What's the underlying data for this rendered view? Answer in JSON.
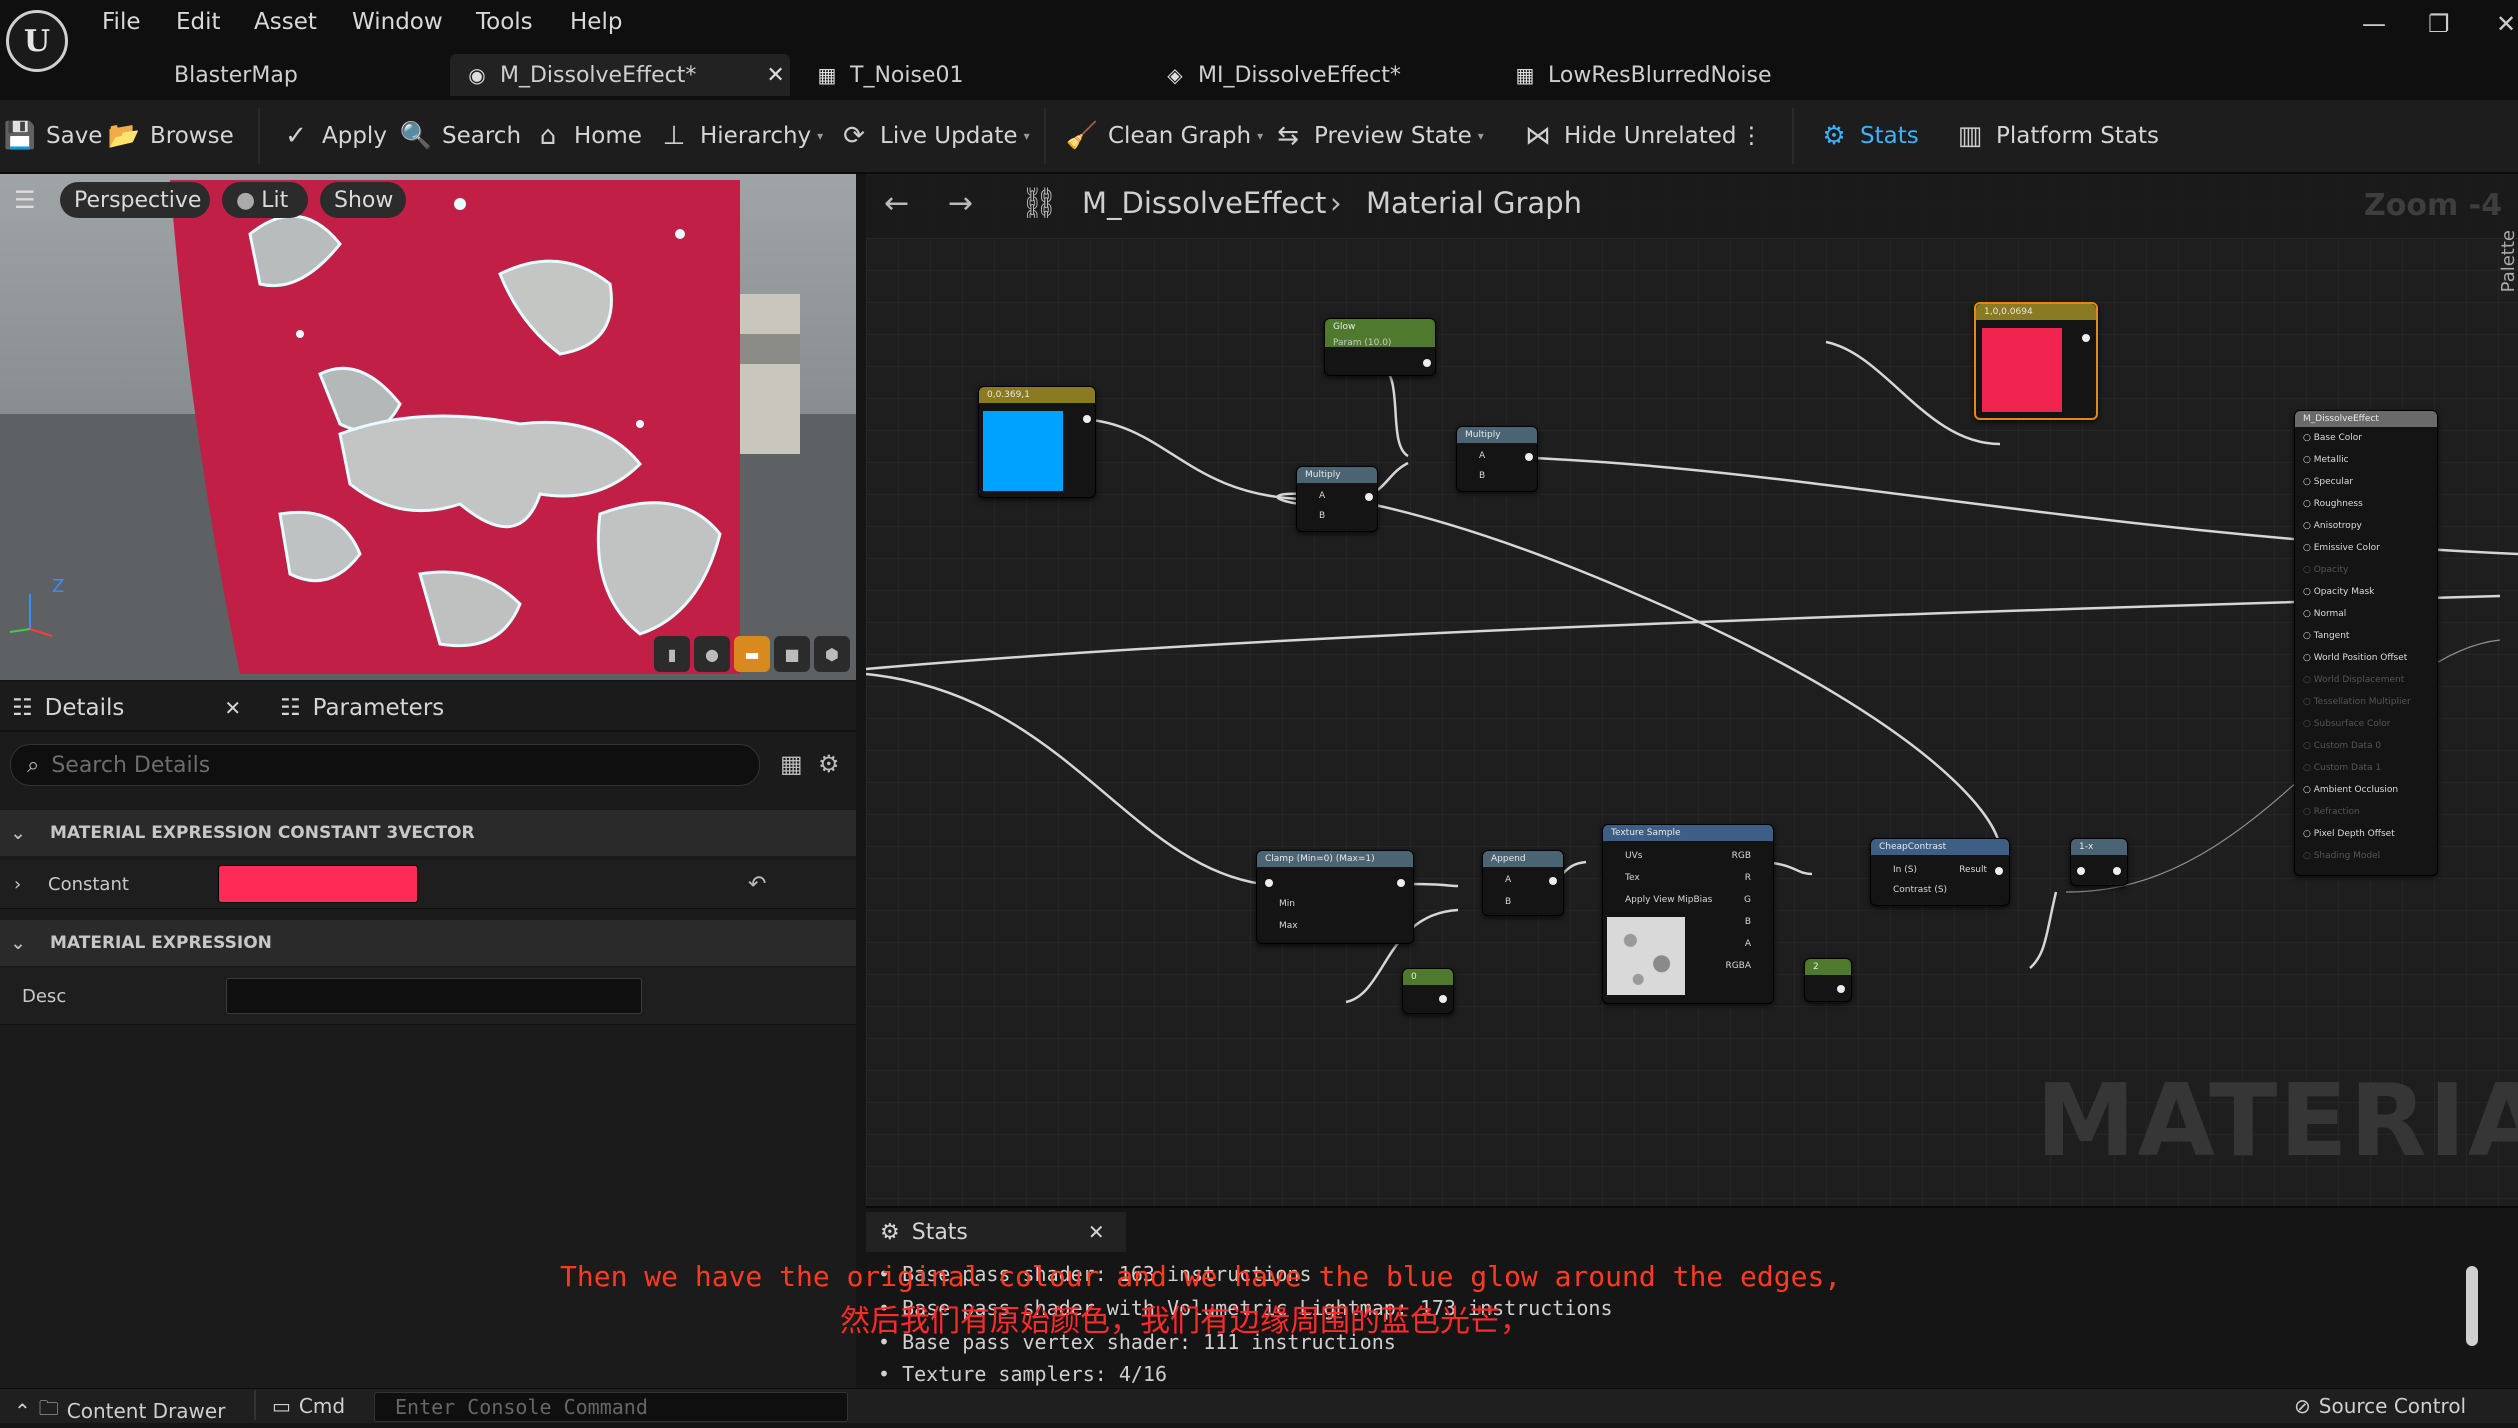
{
  "menu": [
    "File",
    "Edit",
    "Asset",
    "Window",
    "Tools",
    "Help"
  ],
  "tabs": [
    {
      "label": "BlasterMap",
      "icon": "map-icon"
    },
    {
      "label": "M_DissolveEffect*",
      "icon": "material-icon"
    },
    {
      "label": "T_Noise01",
      "icon": "texture-icon"
    },
    {
      "label": "MI_DissolveEffect*",
      "icon": "material-instance-icon"
    },
    {
      "label": "LowResBlurredNoise",
      "icon": "texture-icon"
    }
  ],
  "toolbar": {
    "save": "Save",
    "browse": "Browse",
    "apply": "Apply",
    "search": "Search",
    "home": "Home",
    "hierarchy": "Hierarchy",
    "live_update": "Live Update",
    "clean_graph": "Clean Graph",
    "preview_state": "Preview State",
    "hide_unrelated": "Hide Unrelated",
    "stats": "Stats",
    "platform_stats": "Platform Stats"
  },
  "viewport": {
    "perspective": "Perspective",
    "lit": "Lit",
    "show": "Show",
    "axis_z": "Z"
  },
  "details": {
    "tab_details": "Details",
    "tab_parameters": "Parameters",
    "search_placeholder": "Search Details",
    "section1": "MATERIAL EXPRESSION CONSTANT 3VECTOR",
    "constant_label": "Constant",
    "constant_color": "#ff2a55",
    "section2": "MATERIAL EXPRESSION",
    "desc_label": "Desc"
  },
  "graph": {
    "breadcrumb_asset": "M_DissolveEffect",
    "breadcrumb_graph": "Material Graph",
    "zoom": "Zoom -4",
    "watermark": "MATERIAL",
    "palette": "Palette",
    "nodes": {
      "blue_const": "0,0.369,1",
      "glow": "Glow",
      "glow_sub": "Param (10.0)",
      "multiply": "Multiply",
      "red_const": "1,0,0.0694",
      "clamp": "Clamp (Min=0) (Max=1)",
      "append": "Append",
      "texture_sample": "Texture Sample",
      "cheap_contrast": "CheapContrast",
      "one_x": "1-x",
      "zero": "0",
      "two": "2",
      "result_title": "M_DissolveEffect",
      "pins_a": "A",
      "pins_b": "B",
      "min": "Min",
      "max": "Max",
      "uvs": "UVs",
      "tex": "Tex",
      "apply_view_mip": "Apply View MipBias",
      "rgb": "RGB",
      "r": "R",
      "g": "G",
      "bv": "B",
      "alpha": "A",
      "rgba": "RGBA",
      "in_s": "In (S)",
      "contrast_s": "Contrast (S)",
      "result": "Result"
    },
    "result_pins": [
      "Base Color",
      "Metallic",
      "Specular",
      "Roughness",
      "Anisotropy",
      "Emissive Color",
      "Opacity",
      "Opacity Mask",
      "Normal",
      "Tangent",
      "World Position Offset",
      "World Displacement",
      "Tessellation Multiplier",
      "Subsurface Color",
      "Custom Data 0",
      "Custom Data 1",
      "Ambient Occlusion",
      "Refraction",
      "Pixel Depth Offset",
      "Shading Model"
    ],
    "colors": {
      "blue": "#00a2ff",
      "red": "#f0244f"
    }
  },
  "stats": {
    "title": "Stats",
    "lines": [
      "Base pass shader: 163 instructions",
      "Base pass shader with Volumetric Lightmap: 173 instructions",
      "Base pass vertex shader: 111 instructions",
      "Texture samplers: 4/16"
    ]
  },
  "subtitle": {
    "en": "Then we have the original colour and we have the blue glow around the edges,",
    "zh": "然后我们有原始颜色，我们有边缘周围的蓝色光芒，"
  },
  "bottom": {
    "content_drawer": "Content Drawer",
    "cmd": "Cmd",
    "console_placeholder": "Enter Console Command",
    "source_control": "Source Control"
  }
}
